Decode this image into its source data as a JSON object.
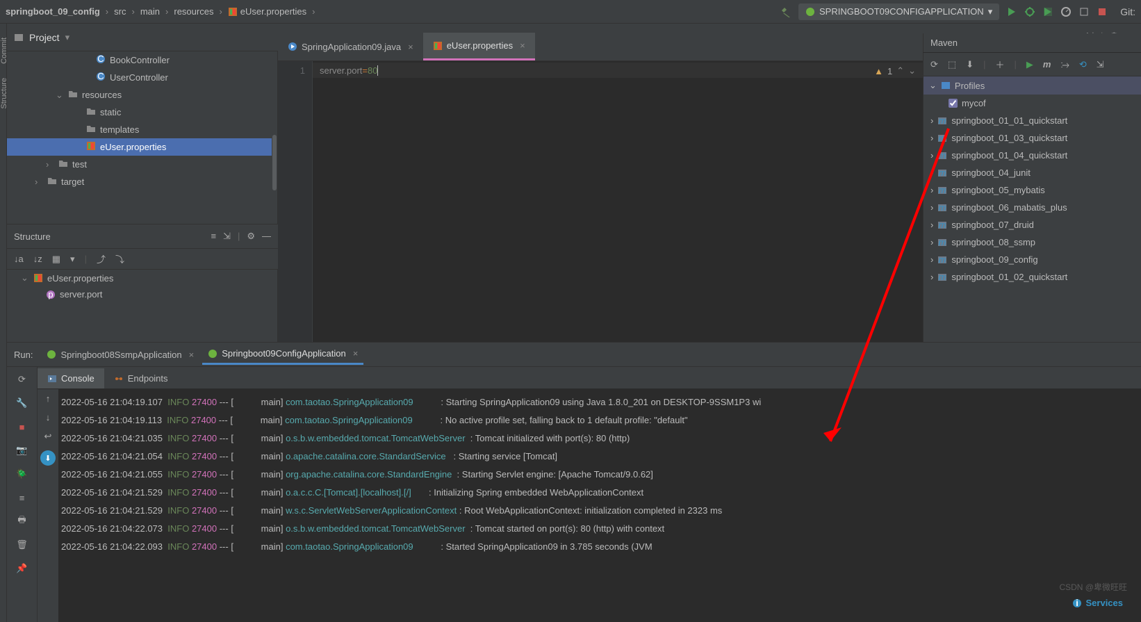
{
  "breadcrumbs": [
    "springboot_09_config",
    "src",
    "main",
    "resources",
    "eUser.properties"
  ],
  "topbar": {
    "run_config": "SPRINGBOOT09CONFIGAPPLICATION",
    "git_label": "Git:"
  },
  "project": {
    "title": "Project",
    "items": [
      {
        "indent": 110,
        "icon": "class",
        "label": "BookController"
      },
      {
        "indent": 110,
        "icon": "class",
        "label": "UserController"
      },
      {
        "indent": 70,
        "icon": "folder",
        "label": "resources",
        "chev": "v"
      },
      {
        "indent": 96,
        "icon": "folder",
        "label": "static"
      },
      {
        "indent": 96,
        "icon": "folder",
        "label": "templates"
      },
      {
        "indent": 96,
        "icon": "prop",
        "label": "eUser.properties",
        "selected": true
      },
      {
        "indent": 56,
        "icon": "folder",
        "label": "test",
        "chev": ">"
      },
      {
        "indent": 40,
        "icon": "folder",
        "label": "target",
        "chev": ">",
        "orange": true
      }
    ]
  },
  "structure": {
    "title": "Structure",
    "root": "eUser.properties",
    "items": [
      {
        "indent": 56,
        "icon": "p",
        "label": "server.port"
      }
    ]
  },
  "editor": {
    "tabs": [
      {
        "label": "SpringApplication09.java",
        "active": false,
        "icon": "java"
      },
      {
        "label": "eUser.properties",
        "active": true,
        "icon": "prop"
      }
    ],
    "line_no": "1",
    "code_key": "server.port",
    "code_eq": "=",
    "code_val": "80",
    "warn_count": "1"
  },
  "maven": {
    "title": "Maven",
    "profiles_label": "Profiles",
    "profile_name": "mycof",
    "modules": [
      "springboot_01_01_quickstart",
      "springboot_01_03_quickstart",
      "springboot_01_04_quickstart",
      "springboot_04_junit",
      "springboot_05_mybatis",
      "springboot_06_mabatis_plus",
      "springboot_07_druid",
      "springboot_08_ssmp",
      "springboot_09_config",
      "springboot_01_02_quickstart"
    ]
  },
  "run": {
    "title": "Run:",
    "tabs": [
      {
        "label": "Springboot08SsmpApplication",
        "active": false
      },
      {
        "label": "Springboot09ConfigApplication",
        "active": true
      }
    ],
    "console_tabs": [
      {
        "label": "Console",
        "active": true
      },
      {
        "label": "Endpoints",
        "active": false
      }
    ],
    "lines": [
      {
        "ts": "2022-05-16 21:04:19.107",
        "lv": "INFO",
        "pid": "27400",
        "th": "main",
        "cls": "com.taotao.SpringApplication09",
        "msg": "Starting SpringApplication09 using Java 1.8.0_201 on DESKTOP-9SSM1P3 wi"
      },
      {
        "ts": "2022-05-16 21:04:19.113",
        "lv": "INFO",
        "pid": "27400",
        "th": "main",
        "cls": "com.taotao.SpringApplication09",
        "msg": "No active profile set, falling back to 1 default profile: \"default\""
      },
      {
        "ts": "2022-05-16 21:04:21.035",
        "lv": "INFO",
        "pid": "27400",
        "th": "main",
        "cls": "o.s.b.w.embedded.tomcat.TomcatWebServer",
        "msg": "Tomcat initialized with port(s): 80 (http)"
      },
      {
        "ts": "2022-05-16 21:04:21.054",
        "lv": "INFO",
        "pid": "27400",
        "th": "main",
        "cls": "o.apache.catalina.core.StandardService",
        "msg": "Starting service [Tomcat]"
      },
      {
        "ts": "2022-05-16 21:04:21.055",
        "lv": "INFO",
        "pid": "27400",
        "th": "main",
        "cls": "org.apache.catalina.core.StandardEngine",
        "msg": "Starting Servlet engine: [Apache Tomcat/9.0.62]"
      },
      {
        "ts": "2022-05-16 21:04:21.529",
        "lv": "INFO",
        "pid": "27400",
        "th": "main",
        "cls": "o.a.c.c.C.[Tomcat].[localhost].[/]",
        "msg": "Initializing Spring embedded WebApplicationContext"
      },
      {
        "ts": "2022-05-16 21:04:21.529",
        "lv": "INFO",
        "pid": "27400",
        "th": "main",
        "cls": "w.s.c.ServletWebServerApplicationContext",
        "msg": "Root WebApplicationContext: initialization completed in 2323 ms"
      },
      {
        "ts": "2022-05-16 21:04:22.073",
        "lv": "INFO",
        "pid": "27400",
        "th": "main",
        "cls": "o.s.b.w.embedded.tomcat.TomcatWebServer",
        "msg": "Tomcat started on port(s): 80 (http) with context"
      },
      {
        "ts": "2022-05-16 21:04:22.093",
        "lv": "INFO",
        "pid": "27400",
        "th": "main",
        "cls": "com.taotao.SpringApplication09",
        "msg": "Started SpringApplication09 in 3.785 seconds (JVM"
      }
    ]
  },
  "services_label": "Services",
  "watermark": "CSDN @卑微旺旺"
}
